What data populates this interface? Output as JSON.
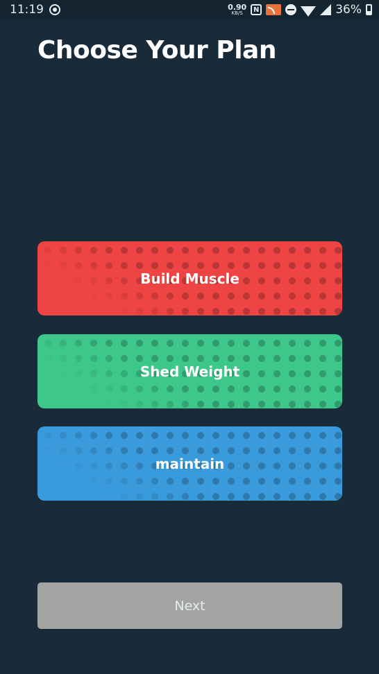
{
  "status_bar": {
    "time": "11:19",
    "net_speed_value": "0.90",
    "net_speed_unit": "KB/S",
    "battery_percent": "36%",
    "icons": [
      "record-icon",
      "nfc-icon",
      "cast-icon",
      "do-not-disturb-icon",
      "wifi-icon",
      "signal-icon",
      "battery-icon"
    ]
  },
  "header": {
    "title": "Choose Your Plan"
  },
  "plans": [
    {
      "label": "Build Muscle",
      "color": "#ef4444"
    },
    {
      "label": "Shed Weight",
      "color": "#3ec78b"
    },
    {
      "label": "maintain",
      "color": "#3a9bdc"
    }
  ],
  "footer": {
    "next_label": "Next",
    "next_color": "#a2a5a4"
  },
  "colors": {
    "background": "#192b38",
    "status_bar": "#142430"
  }
}
